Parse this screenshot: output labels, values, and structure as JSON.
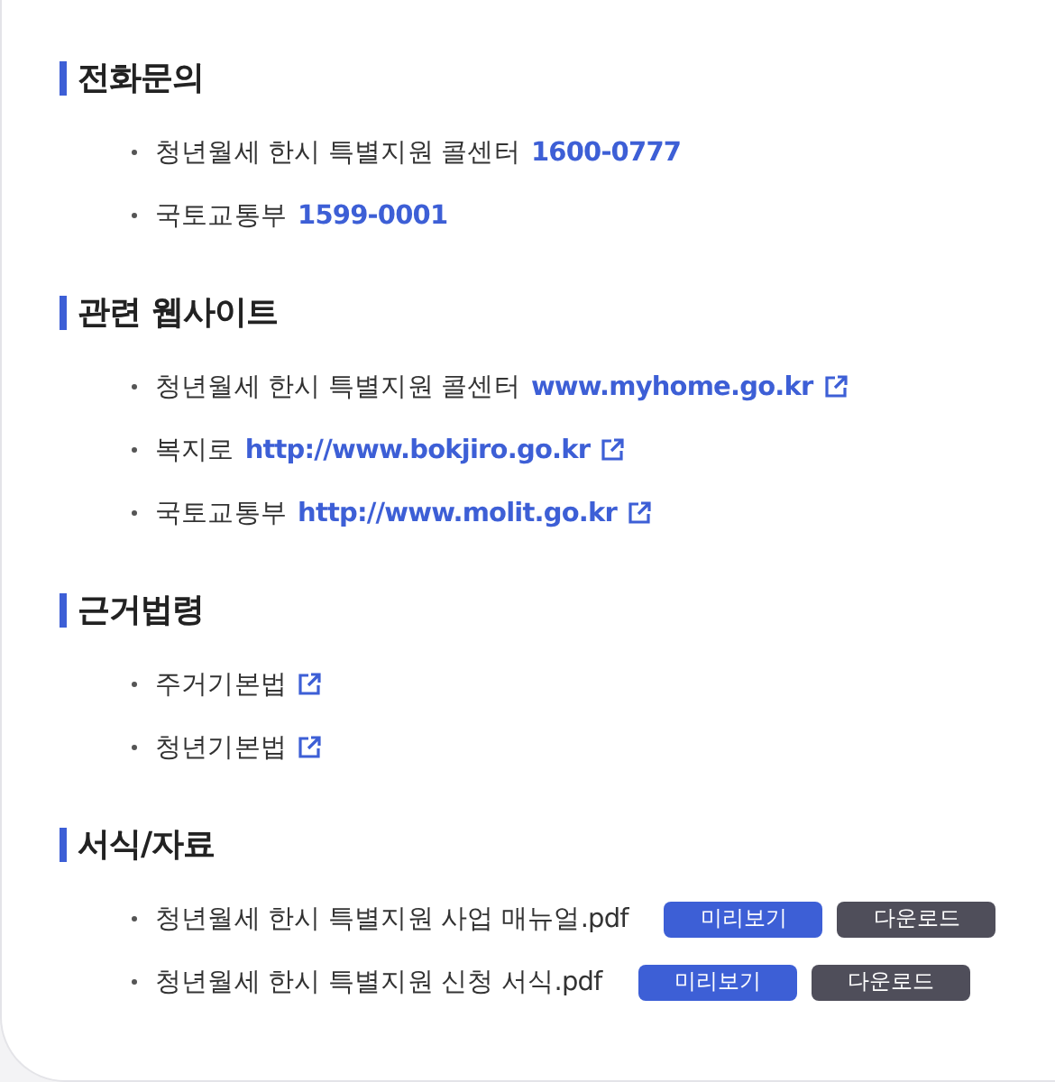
{
  "sections": [
    {
      "title": "전화문의",
      "items": [
        {
          "kind": "phone",
          "text": "청년월세 한시 특별지원 콜센터",
          "value": "1600-0777"
        },
        {
          "kind": "phone",
          "text": "국토교통부",
          "value": "1599-0001"
        }
      ]
    },
    {
      "title": "관련 웹사이트",
      "items": [
        {
          "kind": "link",
          "text": "청년월세 한시 특별지원 콜센터",
          "value": "www.myhome.go.kr"
        },
        {
          "kind": "link",
          "text": "복지로",
          "value": "http://www.bokjiro.go.kr"
        },
        {
          "kind": "link",
          "text": "국토교통부",
          "value": "http://www.molit.go.kr"
        }
      ]
    },
    {
      "title": "근거법령",
      "items": [
        {
          "kind": "law",
          "text": "주거기본법"
        },
        {
          "kind": "law",
          "text": "청년기본법"
        }
      ]
    },
    {
      "title": "서식/자료",
      "items": [
        {
          "kind": "file",
          "text": "청년월세 한시 특별지원 사업 매뉴얼.pdf",
          "buttons": [
            "미리보기",
            "다운로드"
          ]
        },
        {
          "kind": "file",
          "text": "청년월세 한시 특별지원 신청 서식.pdf",
          "buttons": [
            "미리보기",
            "다운로드"
          ]
        }
      ]
    }
  ]
}
